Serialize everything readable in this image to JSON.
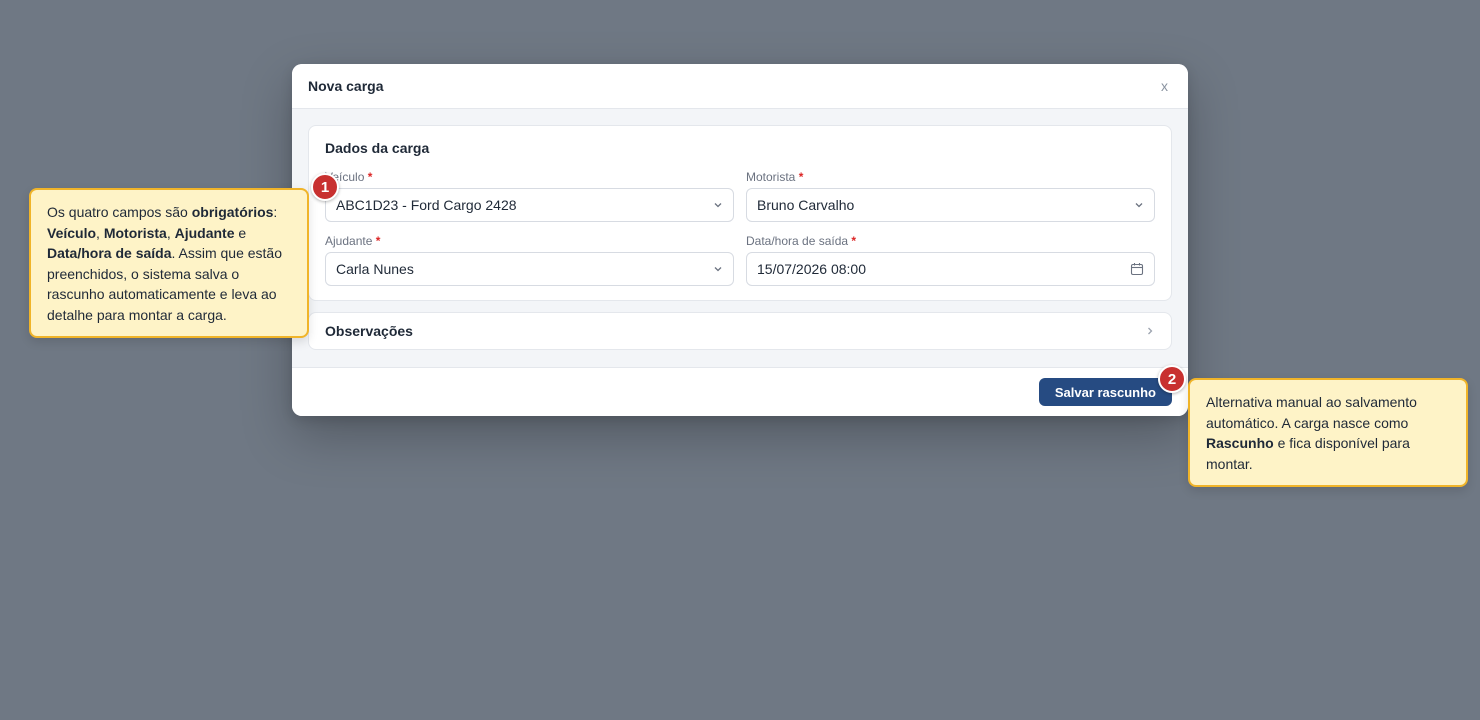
{
  "modal": {
    "title": "Nova carga",
    "close_label": "x",
    "section_title": "Dados da carga",
    "fields": {
      "veiculo": {
        "label": "Veículo",
        "value": "ABC1D23 - Ford Cargo 2428"
      },
      "motorista": {
        "label": "Motorista",
        "value": "Bruno Carvalho"
      },
      "ajudante": {
        "label": "Ajudante",
        "value": "Carla Nunes"
      },
      "data_saida": {
        "label": "Data/hora de saída",
        "value": "15/07/2026 08:00"
      }
    },
    "required_mark": "*",
    "observacoes_title": "Observações",
    "save_label": "Salvar rascunho"
  },
  "tips": {
    "tip1": {
      "badge": "1",
      "t1": "Os quatro campos são ",
      "b1": "obrigatórios",
      "t2": ": ",
      "b2": "Veículo",
      "t3": ", ",
      "b3": "Motorista",
      "t4": ", ",
      "b4": "Ajudante",
      "t5": " e ",
      "b5": "Data/hora de saída",
      "t6": ". Assim que estão preenchidos, o sistema salva o rascunho automaticamente e leva ao detalhe para montar a carga."
    },
    "tip2": {
      "badge": "2",
      "t1": "Alternativa manual ao salvamento automático. A carga nasce como ",
      "b1": "Rascunho",
      "t2": " e fica disponível para montar."
    }
  },
  "colors": {
    "backdrop": "#6f7884",
    "primary": "#264b82",
    "tip_bg": "#fef3c7",
    "tip_border": "#f0b429",
    "badge": "#c8302f",
    "required": "#dc2626"
  },
  "icons": {
    "select": "chevron-down-icon",
    "date": "calendar-icon",
    "expand": "chevron-right-icon",
    "close": "close-icon"
  }
}
